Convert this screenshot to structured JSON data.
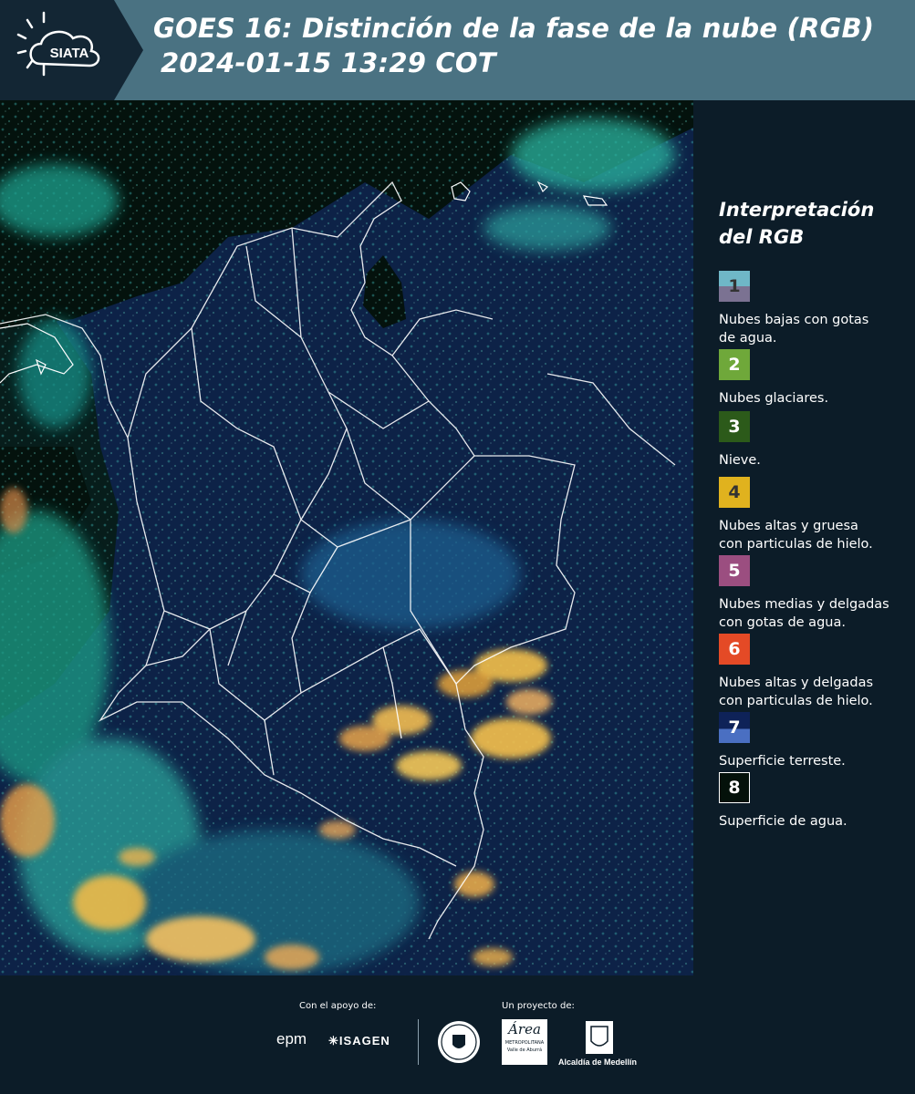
{
  "header": {
    "title_line1": "GOES 16: Distinción de la fase de la nube (RGB)",
    "title_line2": "2024-01-15 13:29 COT",
    "logo_text": "SIATA",
    "bg_color": "#4a7282"
  },
  "legend": {
    "title_line1": "Interpretación",
    "title_line2": "del RGB",
    "items": [
      {
        "num": "1",
        "label_line1": "Nubes bajas con gotas",
        "label_line2": "de agua.",
        "color": "#6fb7c7",
        "color2": "#7b7292"
      },
      {
        "num": "2",
        "label_line1": "Nubes glaciares.",
        "label_line2": "",
        "color": "#6fa83a"
      },
      {
        "num": "3",
        "label_line1": "Nieve.",
        "label_line2": "",
        "color": "#2c5a1a"
      },
      {
        "num": "4",
        "label_line1": "Nubes altas y gruesa",
        "label_line2": "con particulas de hielo.",
        "color": "#e0b21e"
      },
      {
        "num": "5",
        "label_line1": "Nubes medias y delgadas",
        "label_line2": "con gotas de agua.",
        "color": "#9b4e80"
      },
      {
        "num": "6",
        "label_line1": "Nubes altas y delgadas",
        "label_line2": "con particulas de hielo.",
        "color": "#e44a26"
      },
      {
        "num": "7",
        "label_line1": "Superficie terreste.",
        "label_line2": "",
        "color": "#0e2258",
        "color2": "#4a6fc2"
      },
      {
        "num": "8",
        "label_line1": "Superficie de agua.",
        "label_line2": "",
        "color": "#04110a"
      }
    ]
  },
  "footer": {
    "support_label": "Con el apoyo de:",
    "project_label": "Un proyecto de:",
    "sponsor1": "epm",
    "sponsor2": "ISAGEN",
    "partner_area1": "Área",
    "partner_area2": "METROPOLITANA",
    "partner_area3": "Valle de Aburrá",
    "partner_alcaldia": "Alcaldía de Medellín"
  }
}
